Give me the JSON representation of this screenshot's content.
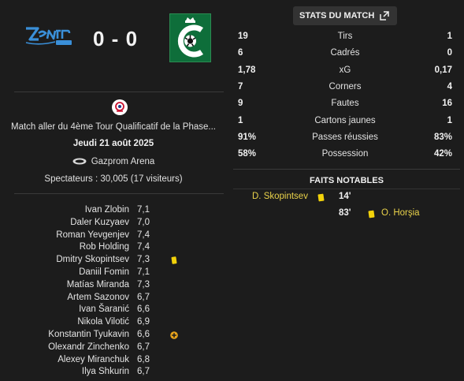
{
  "match": {
    "score": "0 - 0",
    "competition": "Match aller du 4ème Tour Qualificatif de la Phase...",
    "date": "Jeudi 21 août 2025",
    "stadium": "Gazprom Arena",
    "attendance": "Spectateurs : 30,005 (17 visiteurs)"
  },
  "players": [
    {
      "name": "Ivan Zlobin",
      "rating": "7,1",
      "icon": ""
    },
    {
      "name": "Daler Kuzyaev",
      "rating": "7,0",
      "icon": ""
    },
    {
      "name": "Roman Yevgenjev",
      "rating": "7,4",
      "icon": ""
    },
    {
      "name": "Rob Holding",
      "rating": "7,4",
      "icon": ""
    },
    {
      "name": "Dmitry Skopintsev",
      "rating": "7,3",
      "icon": "yellow-card-icon"
    },
    {
      "name": "Daniil Fomin",
      "rating": "7,1",
      "icon": ""
    },
    {
      "name": "Matías Miranda",
      "rating": "7,3",
      "icon": ""
    },
    {
      "name": "Artem Sazonov",
      "rating": "6,7",
      "icon": ""
    },
    {
      "name": "Ivan Šaranić",
      "rating": "6,6",
      "icon": ""
    },
    {
      "name": "Nikola Vilotić",
      "rating": "6,9",
      "icon": ""
    },
    {
      "name": "Konstantin Tyukavin",
      "rating": "6,6",
      "icon": "substitution-icon"
    },
    {
      "name": "Olexandr Zinchenko",
      "rating": "6,7",
      "icon": ""
    },
    {
      "name": "Alexey Miranchuk",
      "rating": "6,8",
      "icon": ""
    },
    {
      "name": "Ilya Shkurin",
      "rating": "6,7",
      "icon": ""
    }
  ],
  "stats": {
    "title": "STATS DU MATCH",
    "rows": [
      {
        "label": "Tirs",
        "home": "19",
        "away": "1"
      },
      {
        "label": "Cadrés",
        "home": "6",
        "away": "0"
      },
      {
        "label": "xG",
        "home": "1,78",
        "away": "0,17"
      },
      {
        "label": "Corners",
        "home": "7",
        "away": "4"
      },
      {
        "label": "Fautes",
        "home": "9",
        "away": "16"
      },
      {
        "label": "Cartons jaunes",
        "home": "1",
        "away": "1"
      },
      {
        "label": "Passes réussies",
        "home": "91%",
        "away": "83%"
      },
      {
        "label": "Possession",
        "home": "58%",
        "away": "42%"
      }
    ]
  },
  "facts": {
    "title": "FAITS NOTABLES",
    "events": [
      {
        "side": "home",
        "player": "D. Skopintsev",
        "minute": "14'",
        "type": "yellow-card"
      },
      {
        "side": "away",
        "player": "O. Horşia",
        "minute": "83'",
        "type": "yellow-card"
      }
    ]
  },
  "colors": {
    "background": "#1c1c1c",
    "yellow_card": "#f2d20a",
    "highlight_name": "#e8d14a",
    "zenit_blue": "#3a8fd8",
    "cercle_green": "#0e6e3a"
  }
}
